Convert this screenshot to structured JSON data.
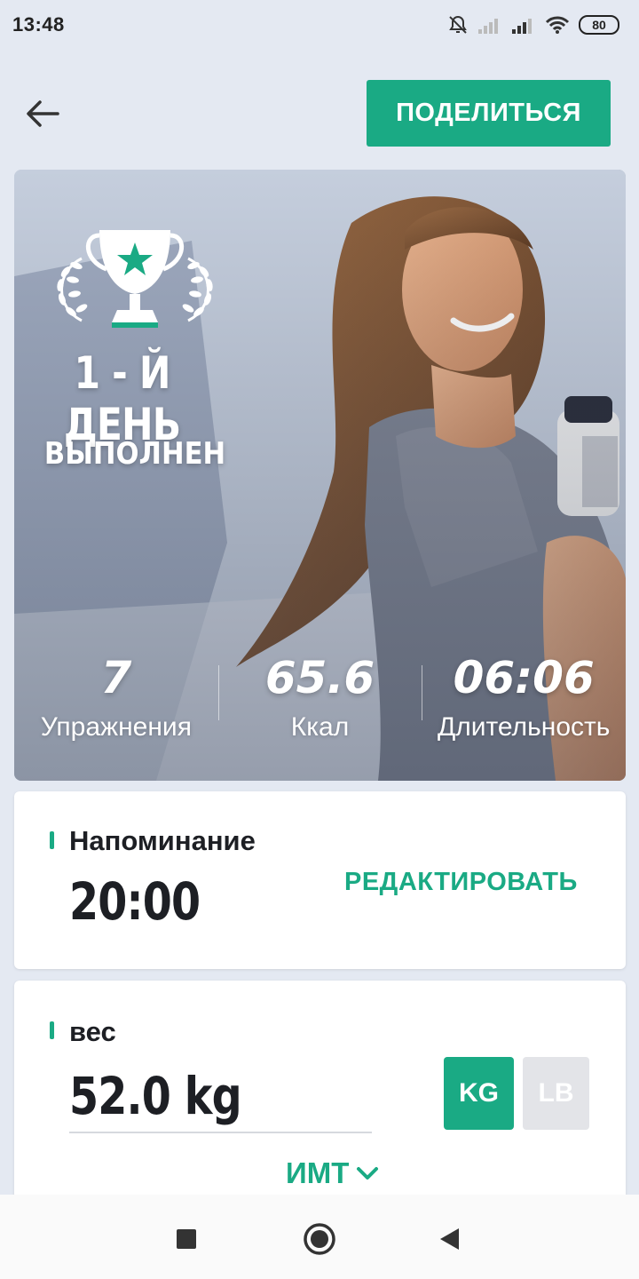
{
  "status_bar": {
    "time": "13:48",
    "battery": "80",
    "icons": [
      "bell-off-icon",
      "signal-icon",
      "signal-icon",
      "wifi-icon",
      "battery-icon"
    ]
  },
  "header": {
    "back_icon": "arrow-left-icon",
    "share_label": "ПОДЕЛИТЬСЯ"
  },
  "hero": {
    "trophy_icon": "trophy-icon",
    "title": "1 - Й ДЕНЬ",
    "subtitle": "ВЫПОЛНЕН",
    "stats": [
      {
        "value": "7",
        "label": "Упражнения"
      },
      {
        "value": "65.6",
        "label": "Ккал"
      },
      {
        "value": "06:06",
        "label": "Длительность"
      }
    ]
  },
  "reminder": {
    "label": "Напоминание",
    "time": "20:00",
    "edit_label": "РЕДАКТИРОВАТЬ"
  },
  "weight": {
    "label": "вес",
    "value": "52.0 kg",
    "unit_kg": "KG",
    "unit_lb": "LB",
    "selected_unit": "KG",
    "bmi_label": "ИМТ"
  },
  "colors": {
    "accent": "#1aaa84",
    "background": "#e4e9f2",
    "inactive_button": "#e3e4e8"
  },
  "navbar": {
    "icons": [
      "square-icon",
      "circle-home-icon",
      "triangle-back-icon"
    ]
  }
}
